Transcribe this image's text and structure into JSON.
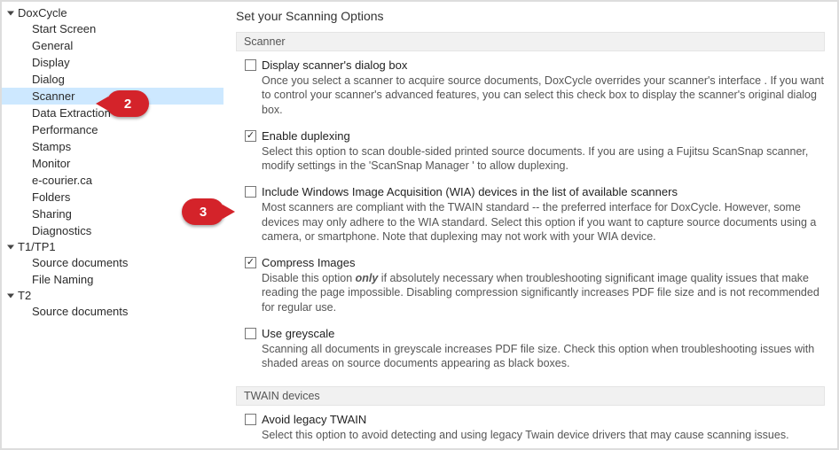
{
  "sidebar": {
    "groups": [
      {
        "label": "DoxCycle",
        "items": [
          {
            "label": "Start Screen",
            "selected": false
          },
          {
            "label": "General",
            "selected": false
          },
          {
            "label": "Display",
            "selected": false
          },
          {
            "label": "Dialog",
            "selected": false
          },
          {
            "label": "Scanner",
            "selected": true
          },
          {
            "label": "Data Extraction",
            "selected": false
          },
          {
            "label": "Performance",
            "selected": false
          },
          {
            "label": "Stamps",
            "selected": false
          },
          {
            "label": "Monitor",
            "selected": false
          },
          {
            "label": "e-courier.ca",
            "selected": false
          },
          {
            "label": "Folders",
            "selected": false
          },
          {
            "label": "Sharing",
            "selected": false
          },
          {
            "label": "Diagnostics",
            "selected": false
          }
        ]
      },
      {
        "label": "T1/TP1",
        "items": [
          {
            "label": "Source documents",
            "selected": false
          },
          {
            "label": "File Naming",
            "selected": false
          }
        ]
      },
      {
        "label": "T2",
        "items": [
          {
            "label": "Source documents",
            "selected": false
          }
        ]
      }
    ]
  },
  "page": {
    "title": "Set your Scanning Options",
    "sections": [
      {
        "header": "Scanner",
        "fields": [
          {
            "name": "display-dialog",
            "checked": false,
            "label": "Display scanner's dialog box",
            "desc": "Once you select a scanner to acquire source documents, DoxCycle overrides your scanner's  interface .  If you want to control your scanner's advanced features, you can select this check box to display the scanner's original dialog box."
          },
          {
            "name": "enable-duplexing",
            "checked": true,
            "label": "Enable duplexing",
            "desc": "Select this option to scan double-sided  printed source documents. If you are using a Fujitsu ScanSnap scanner, modify settings  in the 'ScanSnap Manager ' to allow duplexing."
          },
          {
            "name": "include-wia",
            "checked": false,
            "label": "Include Windows Image Acquisition (WIA) devices in the list of available scanners",
            "desc": "Most scanners are compliant with the TWAIN standard -- the preferred interface for DoxCycle. However, some devices may only adhere to the WIA standard. Select this option if you want to capture source documents using a camera, or smartphone. Note that duplexing may not work with your WIA device."
          },
          {
            "name": "compress-images",
            "checked": true,
            "label": "Compress Images",
            "desc_pre": "Disable this option ",
            "desc_em": "only",
            "desc_post": " if absolutely necessary when troubleshooting significant image quality issues that make reading the page impossible. Disabling compression significantly increases PDF file size and is not recommended for regular use."
          },
          {
            "name": "use-greyscale",
            "checked": false,
            "label": "Use greyscale",
            "desc": "Scanning all documents in greyscale increases PDF file size. Check this option when troubleshooting issues with shaded areas on source documents appearing as black boxes."
          }
        ]
      },
      {
        "header": "TWAIN devices",
        "fields": [
          {
            "name": "avoid-legacy-twain",
            "checked": false,
            "label": "Avoid legacy TWAIN",
            "desc": "Select this option to avoid detecting and using legacy Twain device drivers that may cause scanning issues."
          }
        ]
      }
    ]
  },
  "annotations": {
    "callout2": "2",
    "callout3": "3"
  }
}
